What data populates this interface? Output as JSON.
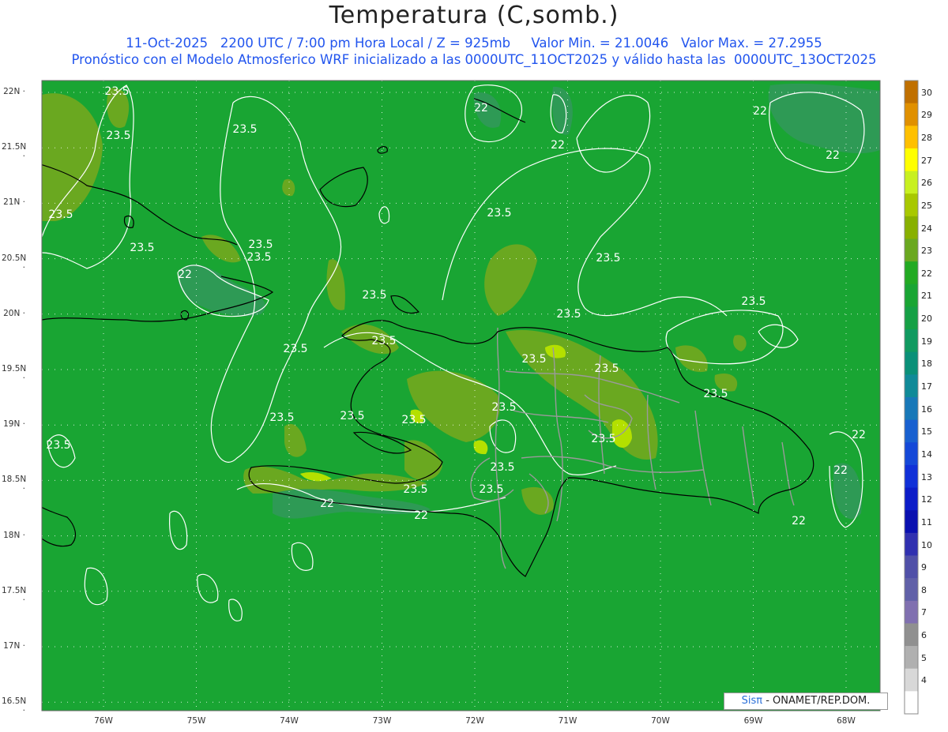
{
  "title": "Temperatura (C,somb.)",
  "subtitle_line1": "11-Oct-2025   2200 UTC / 7:00 pm Hora Local / Z = 925mb     Valor Min. = 21.0046   Valor Max. = 27.2955",
  "subtitle_line2": "Pronóstico con el Modelo Atmosferico WRF inicializado a las 0000UTC_11OCT2025 y válido hasta las  0000UTC_13OCT2025",
  "credit": {
    "logo": "Sisπ",
    "text": " - ONAMET/REP.DOM."
  },
  "lat_labels": [
    "22N",
    "21.5N",
    "21N",
    "20.5N",
    "20N",
    "19.5N",
    "19N",
    "18.5N",
    "18N",
    "17.5N",
    "17N",
    "16.5N"
  ],
  "lon_labels": [
    "76W",
    "75W",
    "74W",
    "73W",
    "72W",
    "71W",
    "70W",
    "69W",
    "68W"
  ],
  "contour_labels": [
    "23.5",
    "22"
  ],
  "colorbar": {
    "ticks": [
      "30",
      "29",
      "28",
      "27",
      "26",
      "25",
      "24",
      "23",
      "22",
      "21",
      "20",
      "19",
      "18",
      "17",
      "16",
      "15",
      "14",
      "13",
      "12",
      "11",
      "10",
      "9",
      "8",
      "7",
      "6",
      "5",
      "4"
    ],
    "colors": [
      "#c07000",
      "#e09000",
      "#ffc000",
      "#ffff00",
      "#c8f020",
      "#a8c800",
      "#88b000",
      "#6aa820",
      "#22aa22",
      "#19a533",
      "#15a045",
      "#109a60",
      "#0a9078",
      "#108a98",
      "#1878b8",
      "#1860d0",
      "#1448d8",
      "#1030d8",
      "#0c1cc8",
      "#0a10b0",
      "#3030b0",
      "#5050a8",
      "#6060a8",
      "#8070b0",
      "#909090",
      "#b0b0b0",
      "#d8d8d8",
      "#ffffff"
    ]
  },
  "colors": {
    "background": "#19a533",
    "warm_area": "#6aa820",
    "hot_area": "#b4e000",
    "cool_area": "#2e9a55",
    "contour": "#ffffff",
    "coastline": "#000000",
    "borders": "#9a9a9a",
    "title": "#222222",
    "subtitle": "#2255ee"
  }
}
